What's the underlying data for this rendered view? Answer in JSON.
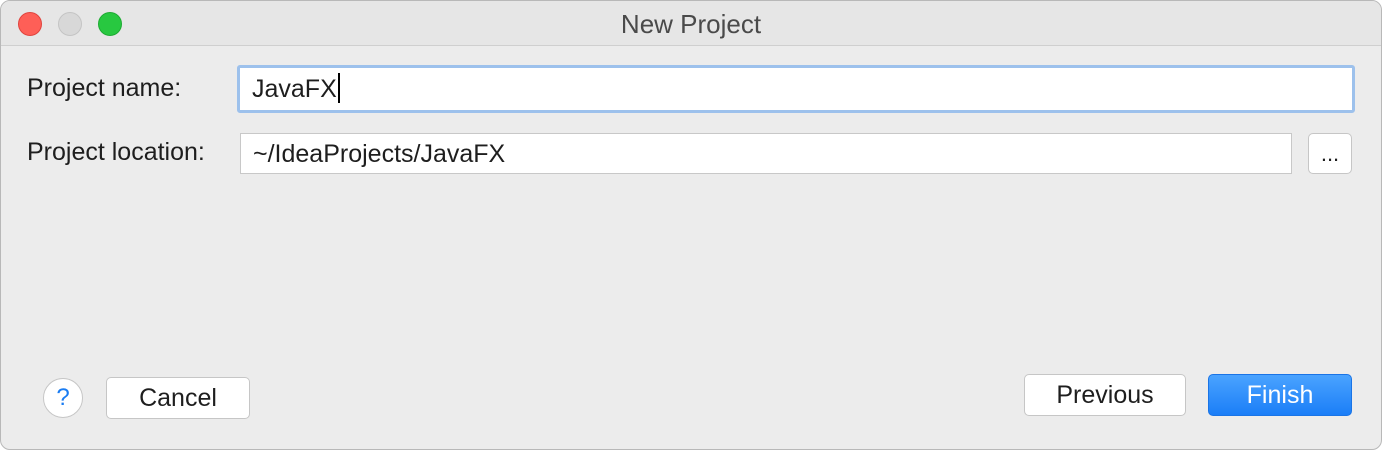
{
  "window": {
    "title": "New Project"
  },
  "form": {
    "project_name_label": "Project name:",
    "project_name_value": "JavaFX",
    "project_location_label": "Project location:",
    "project_location_value": "~/IdeaProjects/JavaFX",
    "browse_label": "..."
  },
  "footer": {
    "help_label": "?",
    "cancel_label": "Cancel",
    "previous_label": "Previous",
    "finish_label": "Finish"
  },
  "colors": {
    "accent": "#1b7ef7",
    "focus_ring": "#9dc1ec",
    "close": "#fe5f57",
    "zoom": "#28c840"
  }
}
